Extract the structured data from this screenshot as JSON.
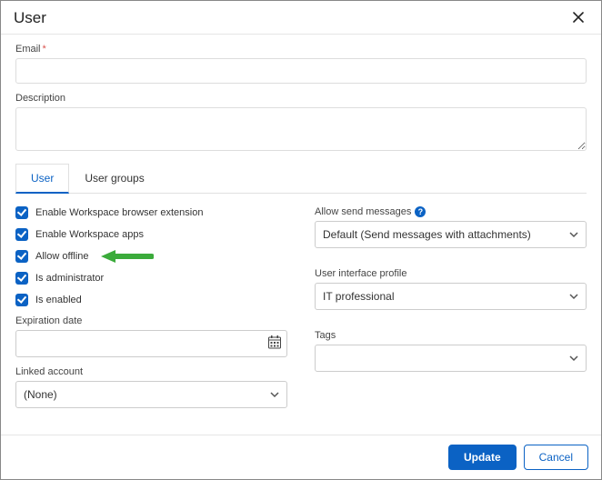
{
  "dialog": {
    "title": "User"
  },
  "fields": {
    "email_label": "Email",
    "email_value": "",
    "description_label": "Description",
    "description_value": ""
  },
  "tabs": {
    "user": "User",
    "user_groups": "User groups"
  },
  "checks": {
    "ext": "Enable Workspace browser extension",
    "apps": "Enable Workspace apps",
    "offline": "Allow offline",
    "admin": "Is administrator",
    "enabled": "Is enabled"
  },
  "left": {
    "expiration_label": "Expiration date",
    "expiration_value": "",
    "linked_label": "Linked account",
    "linked_value": "(None)"
  },
  "right": {
    "allow_send_label": "Allow send messages",
    "allow_send_value": "Default (Send messages with attachments)",
    "ui_profile_label": "User interface profile",
    "ui_profile_value": "IT professional",
    "tags_label": "Tags",
    "tags_value": ""
  },
  "footer": {
    "update": "Update",
    "cancel": "Cancel"
  }
}
